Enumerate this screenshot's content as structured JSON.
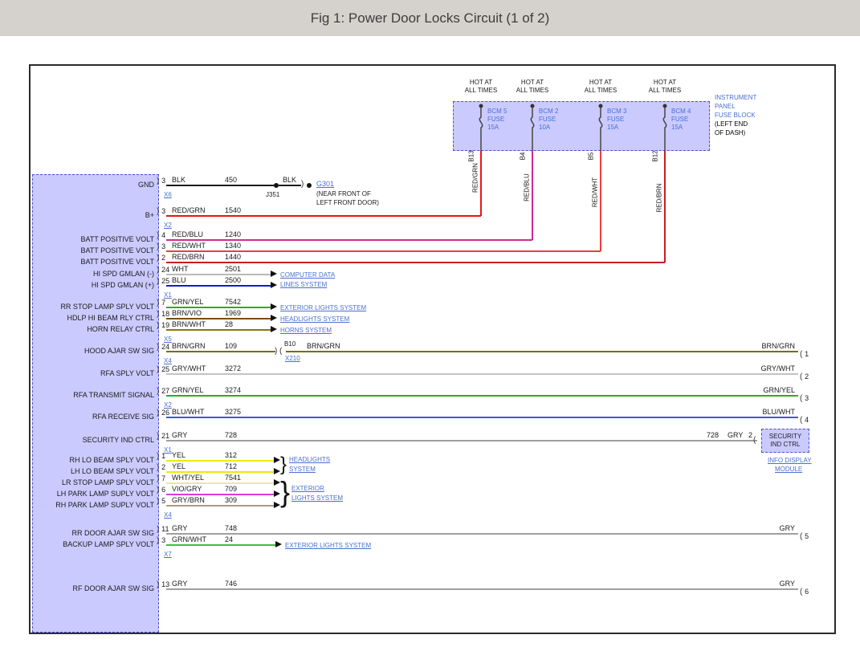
{
  "title": "Fig 1: Power Door Locks Circuit (1 of 2)",
  "colors": {
    "link_blue": "#4a6fd1",
    "module_fill": "#cacaff",
    "module_border": "#5050c8",
    "black_wire": "#1a1a1a",
    "red_grn": "#e81616",
    "red_blu": "#cf2b8e",
    "red_wht": "#ef3b3b",
    "red_brn": "#c61f1f",
    "wht": "#b9b9b9",
    "blu": "#1717dc",
    "grn_yel": "#2fae12",
    "brn_vio": "#7d4a12",
    "brn_wht": "#8a7612",
    "brn_grn": "#71710a",
    "gry_wht": "#c3c3c3",
    "gry": "#9f9f9f",
    "blu_wht": "#3d57e8",
    "yel": "#f0e800",
    "wht_yel": "#e9e6a2",
    "vio_gry": "#dc3cdc",
    "gry_brn": "#ab9a87",
    "grn_wht": "#3bbf3b"
  },
  "fuse_block": {
    "hot_line1": "HOT AT",
    "hot_line2": "ALL TIMES",
    "label_line1": "INSTRUMENT",
    "label_line2": "PANEL",
    "label_line3": "FUSE BLOCK",
    "label_line4": "(LEFT END",
    "label_line5": "OF DASH)",
    "fuses": [
      {
        "name": "BCM 5",
        "type": "FUSE",
        "amps": "15A",
        "pin": "B13",
        "wire": "RED/GRN"
      },
      {
        "name": "BCM 2",
        "type": "FUSE",
        "amps": "10A",
        "pin": "B4",
        "wire": "RED/BLU"
      },
      {
        "name": "BCM 3",
        "type": "FUSE",
        "amps": "15A",
        "pin": "B5",
        "wire": "RED/WHT"
      },
      {
        "name": "BCM 4",
        "type": "FUSE",
        "amps": "15A",
        "pin": "B12",
        "wire": "RED/BRN"
      }
    ]
  },
  "ground": {
    "splice": "J351",
    "wire2": "BLK",
    "ref": "G301",
    "loc1": "(NEAR FRONT OF",
    "loc2": "LEFT FRONT DOOR)"
  },
  "inline": {
    "pin": "B10",
    "conn": "X210"
  },
  "security": {
    "line1": "SECURITY",
    "line2": "IND CTRL",
    "circuit": "728",
    "wire": "GRY",
    "pin": "2",
    "mod1": "INFO DISPLAY",
    "mod2": "MODULE"
  },
  "systems": {
    "cd1": "COMPUTER DATA",
    "cd2": "LINES SYSTEM",
    "ext1": "EXTERIOR LIGHTS SYSTEM",
    "hl1": "HEADLIGHTS SYSTEM",
    "horns": "HORNS SYSTEM",
    "hl2a": "HEADLIGHTS",
    "hl2b": "SYSTEM",
    "ext2a": "EXTERIOR",
    "ext2b": "LIGHTS SYSTEM",
    "ext3": "EXTERIOR LIGHTS SYSTEM"
  },
  "right_pins": [
    {
      "pin": "1",
      "wire": "BRN/GRN"
    },
    {
      "pin": "2",
      "wire": "GRY/WHT"
    },
    {
      "pin": "3",
      "wire": "GRN/YEL"
    },
    {
      "pin": "4",
      "wire": "BLU/WHT"
    },
    {
      "pin": "5",
      "wire": "GRY"
    },
    {
      "pin": "6",
      "wire": "GRY"
    }
  ],
  "module_pins": [
    {
      "label": "GND",
      "pin": "3",
      "wire": "BLK",
      "circuit": "450",
      "connector": "X6"
    },
    {
      "label": "B+",
      "pin": "3",
      "wire": "RED/GRN",
      "circuit": "1540",
      "connector": "X2"
    },
    {
      "label": "BATT POSITIVE VOLT",
      "pin": "4",
      "wire": "RED/BLU",
      "circuit": "1240"
    },
    {
      "label": "BATT POSITIVE VOLT",
      "pin": "3",
      "wire": "RED/WHT",
      "circuit": "1340"
    },
    {
      "label": "BATT POSITIVE VOLT",
      "pin": "2",
      "wire": "RED/BRN",
      "circuit": "1440"
    },
    {
      "label": "HI SPD GMLAN (-)",
      "pin": "24",
      "wire": "WHT",
      "circuit": "2501"
    },
    {
      "label": "HI SPD GMLAN (+)",
      "pin": "25",
      "wire": "BLU",
      "circuit": "2500",
      "connector": "X1"
    },
    {
      "label": "RR STOP LAMP SPLY VOLT",
      "pin": "7",
      "wire": "GRN/YEL",
      "circuit": "7542"
    },
    {
      "label": "HDLP HI BEAM RLY CTRL",
      "pin": "18",
      "wire": "BRN/VIO",
      "circuit": "1969"
    },
    {
      "label": "HORN RELAY CTRL",
      "pin": "19",
      "wire": "BRN/WHT",
      "circuit": "28",
      "connector": "X5"
    },
    {
      "label": "HOOD AJAR SW SIG",
      "pin": "24",
      "wire": "BRN/GRN",
      "circuit": "109",
      "connector": "X4"
    },
    {
      "label": "RFA SPLY VOLT",
      "pin": "25",
      "wire": "GRY/WHT",
      "circuit": "3272"
    },
    {
      "label": "RFA TRANSMIT SIGNAL",
      "pin": "27",
      "wire": "GRN/YEL",
      "circuit": "3274",
      "connector": "X2"
    },
    {
      "label": "RFA RECEIVE SIG",
      "pin": "26",
      "wire": "BLU/WHT",
      "circuit": "3275"
    },
    {
      "label": "SECURITY IND CTRL",
      "pin": "21",
      "wire": "GRY",
      "circuit": "728",
      "connector": "X1"
    },
    {
      "label": "RH LO BEAM SPLY VOLT",
      "pin": "1",
      "wire": "YEL",
      "circuit": "312"
    },
    {
      "label": "LH LO BEAM SPLY VOLT",
      "pin": "2",
      "wire": "YEL",
      "circuit": "712"
    },
    {
      "label": "LR STOP LAMP SPLY VOLT",
      "pin": "7",
      "wire": "WHT/YEL",
      "circuit": "7541"
    },
    {
      "label": "LH PARK LAMP SUPLY VOLT",
      "pin": "6",
      "wire": "VIO/GRY",
      "circuit": "709"
    },
    {
      "label": "RH PARK LAMP SUPLY VOLT",
      "pin": "5",
      "wire": "GRY/BRN",
      "circuit": "309",
      "connector": "X4"
    },
    {
      "label": "RR DOOR AJAR SW SIG",
      "pin": "11",
      "wire": "GRY",
      "circuit": "748"
    },
    {
      "label": "BACKUP LAMP SPLY VOLT",
      "pin": "3",
      "wire": "GRN/WHT",
      "circuit": "24",
      "connector": "X7"
    },
    {
      "label": "RF DOOR AJAR SW SIG",
      "pin": "13",
      "wire": "GRY",
      "circuit": "746"
    }
  ]
}
